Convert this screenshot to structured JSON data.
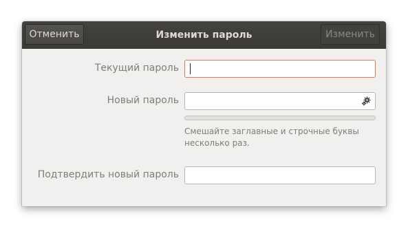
{
  "header": {
    "cancel_label": "Отменить",
    "title": "Изменить пароль",
    "change_label": "Изменить"
  },
  "form": {
    "current": {
      "label": "Текущий пароль",
      "value": ""
    },
    "new": {
      "label": "Новый пароль",
      "value": "",
      "icon": "gear-icon"
    },
    "strength": {
      "level": 0
    },
    "hint": "Смешайте заглавные и строчные буквы несколько раз.",
    "confirm": {
      "label": "Подтвердить новый пароль",
      "value": ""
    }
  },
  "colors": {
    "headerbar": "#3e3d39",
    "focus_border": "#e0774a",
    "dialog_bg": "#f1f0ee"
  }
}
